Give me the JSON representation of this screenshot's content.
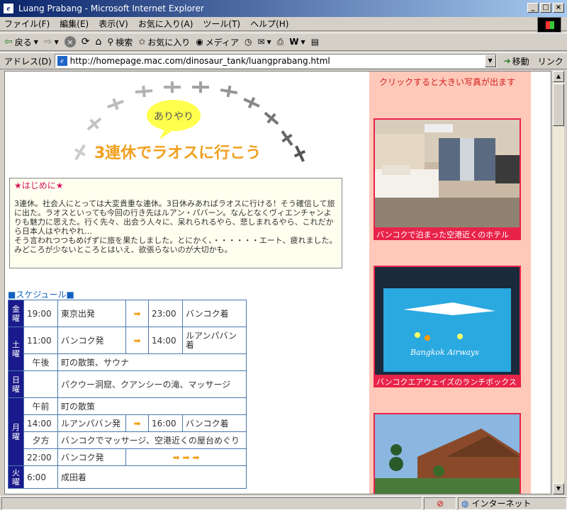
{
  "window": {
    "title": "Luang Prabang - Microsoft Internet Explorer"
  },
  "menu": [
    "ファイル(F)",
    "編集(E)",
    "表示(V)",
    "お気に入り(A)",
    "ツール(T)",
    "ヘルプ(H)"
  ],
  "toolbar": {
    "back": "戻る",
    "search": "検索",
    "favorites": "お気に入り",
    "media": "メディア"
  },
  "address": {
    "label": "アドレス(D)",
    "url": "http://homepage.mac.com/dinosaur_tank/luangprabang.html",
    "go": "移動",
    "links": "リンク"
  },
  "status": {
    "zone": "インターネット"
  },
  "banner": {
    "bubble": "ありやり",
    "title": "3連休でラオスに行こう"
  },
  "intro": {
    "heading": "★はじめに★",
    "body": "3連休。社会人にとっては大変貴重な連休。3日休みあればラオスに行ける！そう確信して旅に出た。ラオスといっても今回の行き先はルアン・パバーン。なんとなくヴィエンチャンよりも魅力に思えた。行く先々、出会う人々に、呆れられるやら、悲しまれるやら、これだから日本人はやれやれ…",
    "body2": "そう言われつつもめげずに旅を果たしました。とにかく、・・・・・・エート、疲れました。",
    "body3": "みどころが少ないところとはいえ、欲張らないのが大切かも。"
  },
  "schedule": {
    "heading": "■スケジュール■",
    "days": {
      "fri": "金曜",
      "sat": "土曜",
      "sun": "日曜",
      "mon": "月曜",
      "tue": "火曜"
    },
    "rows": [
      {
        "time": "19:00",
        "from": "東京出発",
        "arrow": "➡",
        "time2": "23:00",
        "to": "バンコク着"
      },
      {
        "time": "11:00",
        "from": "バンコク発",
        "arrow": "➡",
        "time2": "14:00",
        "to": "ルアンパバン着"
      },
      {
        "time": "午後",
        "text": "町の散策、サウナ"
      },
      {
        "time": "",
        "text": "パクウー洞窟、クアンシーの滝、マッサージ"
      },
      {
        "time": "午前",
        "text": "町の散策"
      },
      {
        "time": "14:00",
        "from": "ルアンパバン発",
        "arrow": "➡",
        "time2": "16:00",
        "to": "バンコク着"
      },
      {
        "time": "夕方",
        "text": "バンコクでマッサージ、空港近くの屋台めぐり"
      },
      {
        "time": "22:00",
        "from": "バンコク発",
        "arrow": "➡ ➡ ➡"
      },
      {
        "time": "6:00",
        "text": "成田着"
      }
    ]
  },
  "sidebar": {
    "note": "クリックすると大きい写真が出ます",
    "photos": [
      "バンコクで泊まった空港近くのホテル",
      "バンコクエアウェイズのランチボックス"
    ],
    "lunchbox_text": "Bangkok Airways"
  }
}
